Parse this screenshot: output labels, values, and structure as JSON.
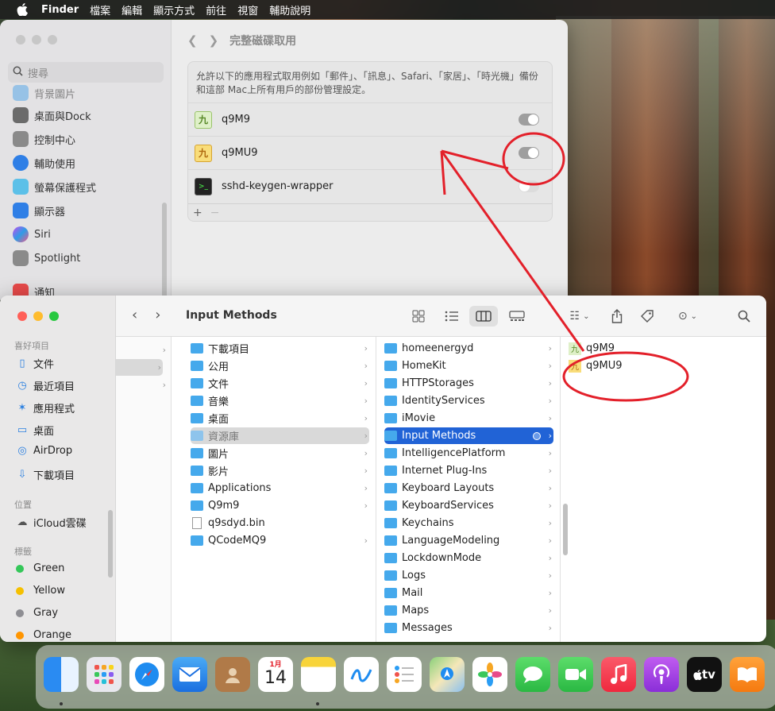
{
  "menubar": {
    "items": [
      "Finder",
      "檔案",
      "編輯",
      "顯示方式",
      "前往",
      "視窗",
      "輔助說明"
    ]
  },
  "settings": {
    "title": "完整磁碟取用",
    "search_placeholder": "搜尋",
    "sidebar": [
      {
        "label": "背景圖片",
        "icon": "wallpaper-icon"
      },
      {
        "label": "桌面與Dock",
        "icon": "dock-icon"
      },
      {
        "label": "控制中心",
        "icon": "control-center-icon"
      },
      {
        "label": "輔助使用",
        "icon": "accessibility-icon"
      },
      {
        "label": "螢幕保護程式",
        "icon": "screensaver-icon"
      },
      {
        "label": "顯示器",
        "icon": "display-icon"
      },
      {
        "label": "Siri",
        "icon": "siri-icon"
      },
      {
        "label": "Spotlight",
        "icon": "spotlight-icon"
      },
      {
        "label": "通知",
        "icon": "notifications-icon"
      }
    ],
    "description": "允許以下的應用程式取用例如「郵件」、「訊息」、Safari、「家居」、「時光機」備份和這部 Mac上所有用戶的部份管理設定。",
    "apps": [
      {
        "name": "q9M9",
        "enabled": true,
        "icon": "q9m9-app-icon"
      },
      {
        "name": "q9MU9",
        "enabled": true,
        "icon": "q9mu9-app-icon"
      },
      {
        "name": "sshd-keygen-wrapper",
        "enabled": false,
        "icon": "terminal-icon"
      }
    ],
    "add_label": "+",
    "remove_label": "−"
  },
  "finder": {
    "title": "Input Methods",
    "sidebar": {
      "favorites_header": "喜好項目",
      "favorites": [
        {
          "label": "文件",
          "icon": "document-icon"
        },
        {
          "label": "最近項目",
          "icon": "recents-icon"
        },
        {
          "label": "應用程式",
          "icon": "applications-icon"
        },
        {
          "label": "桌面",
          "icon": "desktop-icon"
        },
        {
          "label": "AirDrop",
          "icon": "airdrop-icon"
        },
        {
          "label": "下載項目",
          "icon": "downloads-icon"
        }
      ],
      "locations_header": "位置",
      "locations": [
        {
          "label": "iCloud雲碟",
          "icon": "icloud-icon"
        }
      ],
      "tags_header": "標籤",
      "tags": [
        {
          "label": "Green",
          "color": "#34c759"
        },
        {
          "label": "Yellow",
          "color": "#f5c000"
        },
        {
          "label": "Gray",
          "color": "#8e8e93"
        },
        {
          "label": "Orange",
          "color": "#ff9500"
        }
      ]
    },
    "col2": [
      "下載項目",
      "公用",
      "文件",
      "音樂",
      "桌面",
      "資源庫",
      "圖片",
      "影片",
      "Applications",
      "Q9m9",
      "q9sdyd.bin",
      "QCodeMQ9"
    ],
    "col3": [
      "homeenergyd",
      "HomeKit",
      "HTTPStorages",
      "IdentityServices",
      "iMovie",
      "Input Methods",
      "IntelligencePlatform",
      "Internet Plug-Ins",
      "Keyboard Layouts",
      "KeyboardServices",
      "Keychains",
      "LanguageModeling",
      "LockdownMode",
      "Logs",
      "Mail",
      "Maps",
      "Messages"
    ],
    "col4": [
      "q9M9",
      "q9MU9"
    ]
  },
  "dock": {
    "apps": [
      "finder",
      "launchpad",
      "safari",
      "mail",
      "contacts",
      "calendar",
      "notes",
      "freeform",
      "reminders",
      "maps",
      "photos",
      "messages",
      "facetime",
      "music",
      "podcasts",
      "apple-tv",
      "books"
    ],
    "calendar_month": "1月",
    "calendar_day": "14",
    "tv_label": "tv"
  },
  "colors": {
    "accent": "#2163d6",
    "annotation": "#e3202a"
  }
}
